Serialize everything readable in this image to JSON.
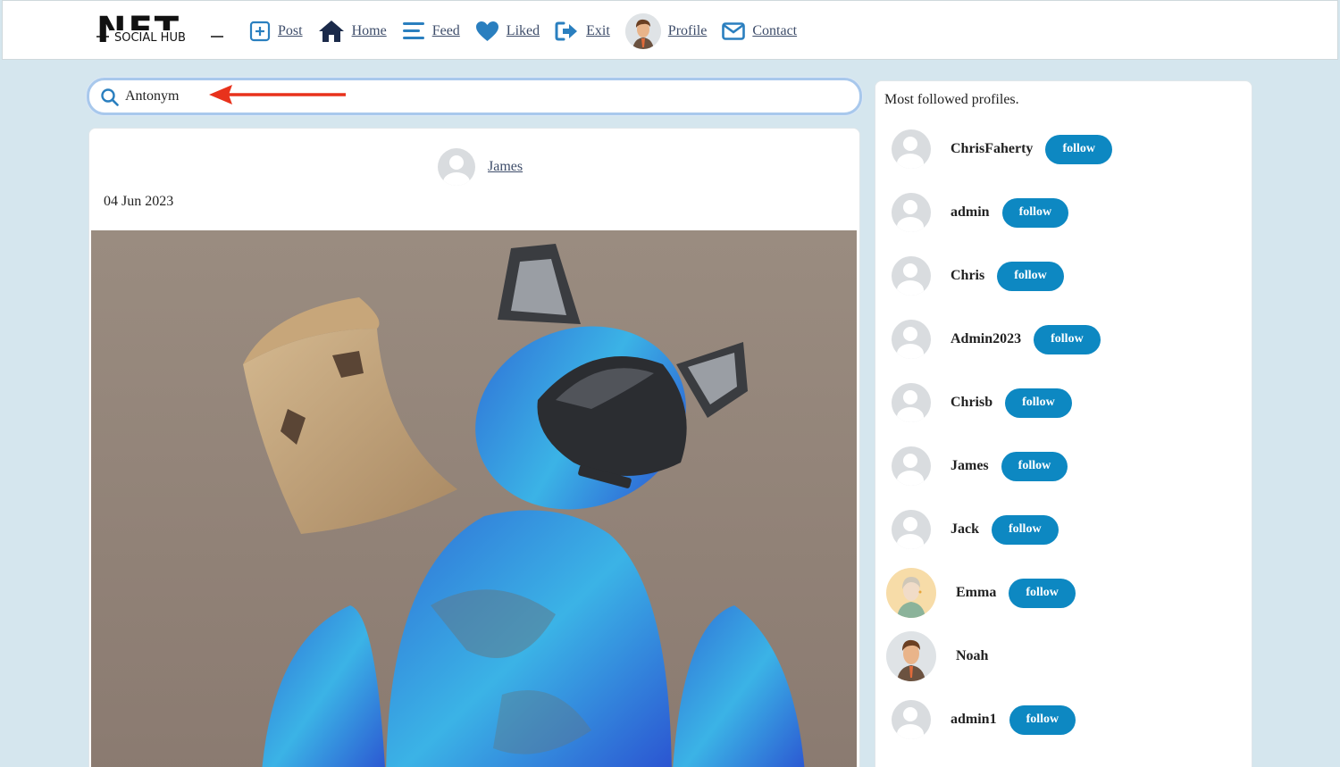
{
  "nav": {
    "logo_alt": "NFT SOCIAL HUB",
    "logo_big": "NFT",
    "logo_small": "SOCIAL HUB",
    "items": [
      {
        "label": "Post",
        "icon": "plus-square-icon"
      },
      {
        "label": "Home",
        "icon": "home-icon"
      },
      {
        "label": "Feed",
        "icon": "menu-lines-icon"
      },
      {
        "label": "Liked",
        "icon": "heart-icon"
      },
      {
        "label": "Exit",
        "icon": "exit-icon"
      },
      {
        "label": "Profile",
        "icon": "user-avatar"
      },
      {
        "label": "Contact",
        "icon": "envelope-icon"
      }
    ],
    "icon_color": "#2a7fbf",
    "home_color": "#1b2a4a"
  },
  "search": {
    "value": "Antonym",
    "placeholder": ""
  },
  "post": {
    "author": "James",
    "date": "04 Jun 2023"
  },
  "sidebar": {
    "title": "Most followed profiles.",
    "follow_label": "follow",
    "profiles": [
      {
        "name": "ChrisFaherty",
        "follow": true,
        "avatar": "default"
      },
      {
        "name": "admin",
        "follow": true,
        "avatar": "default"
      },
      {
        "name": "Chris",
        "follow": true,
        "avatar": "default"
      },
      {
        "name": "Admin2023",
        "follow": true,
        "avatar": "default"
      },
      {
        "name": "Chrisb",
        "follow": true,
        "avatar": "default"
      },
      {
        "name": "James",
        "follow": true,
        "avatar": "default"
      },
      {
        "name": "Jack",
        "follow": true,
        "avatar": "default"
      },
      {
        "name": "Emma",
        "follow": true,
        "avatar": "illustrated-woman"
      },
      {
        "name": "Noah",
        "follow": false,
        "avatar": "illustrated-man"
      },
      {
        "name": "admin1",
        "follow": true,
        "avatar": "default"
      }
    ]
  },
  "colors": {
    "page_bg": "#d5e6ee",
    "follow_button": "#0d88c2",
    "annotation_arrow": "#e8321c"
  }
}
